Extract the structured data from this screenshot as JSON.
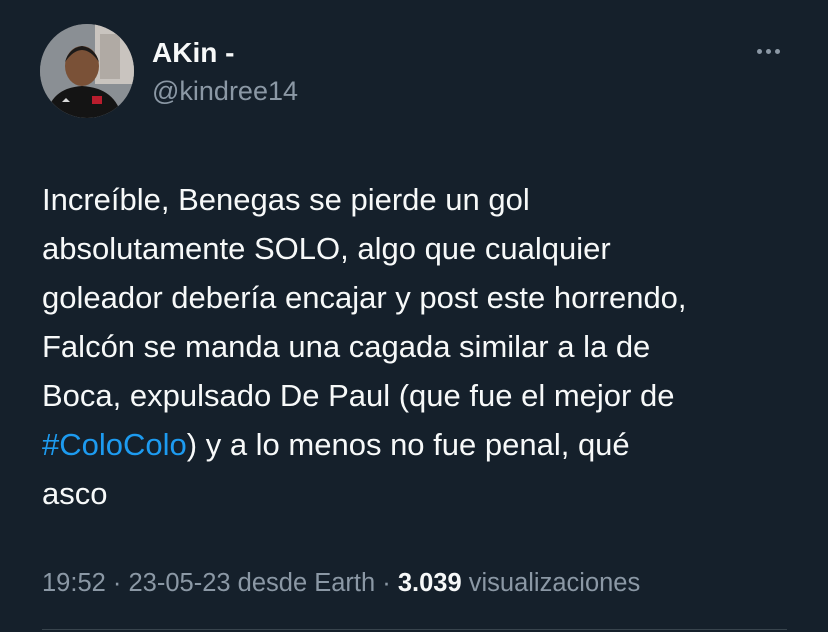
{
  "author": {
    "display_name": "AKin -",
    "handle": "@kindree14",
    "avatar_icon": "profile-photo"
  },
  "more_icon": "ellipsis-icon",
  "tweet": {
    "lines": [
      {
        "text": "Increíble, Benegas se pierde un gol"
      },
      {
        "text": "absolutamente SOLO, algo que cualquier"
      },
      {
        "text": "goleador debería encajar y post este horrendo,"
      },
      {
        "text": "Falcón se manda una cagada similar a la de"
      },
      {
        "text": "Boca, expulsado De Paul (que fue el mejor de"
      },
      {
        "hashtag": "#ColoColo",
        "rest": ") y a lo menos no fue penal, qué"
      },
      {
        "text": "asco"
      }
    ]
  },
  "meta": {
    "time": "19:52",
    "sep1": " · ",
    "date": "23-05-23",
    "source": " desde Earth",
    "sep2": " · ",
    "views_count": "3.039",
    "views_label": " visualizaciones"
  },
  "colors": {
    "background": "#15202b",
    "text": "#f7f9f9",
    "secondary": "#8b98a5",
    "link": "#1d9bf0"
  }
}
